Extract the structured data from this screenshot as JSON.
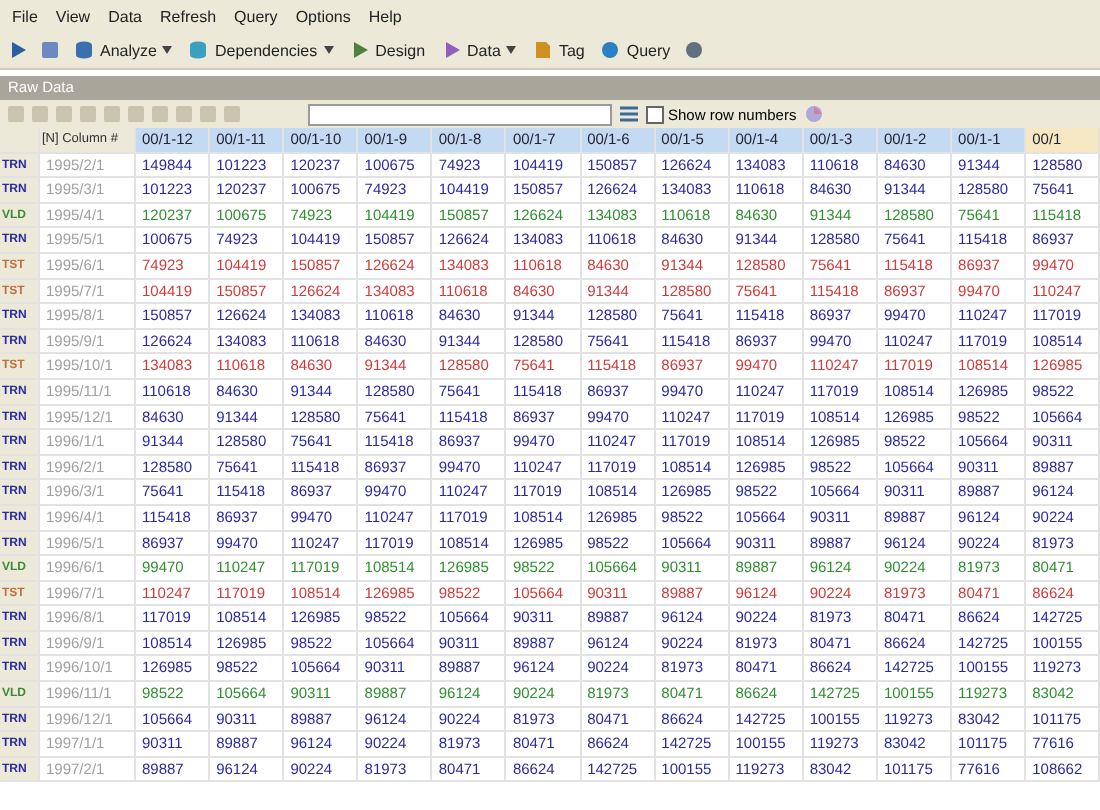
{
  "menu": [
    "File",
    "View",
    "Data",
    "Refresh",
    "Query",
    "Options",
    "Help"
  ],
  "toolbar": [
    {
      "label": "Analyze",
      "dropdown": true
    },
    {
      "label": "Dependencies",
      "dropdown": true
    },
    {
      "label": "Design",
      "dropdown": false
    },
    {
      "label": "Data",
      "dropdown": true
    },
    {
      "label": "Tag",
      "dropdown": false
    },
    {
      "label": "Query",
      "dropdown": false
    }
  ],
  "panel_title": "Raw Data",
  "grid_toolbar": {
    "show_row_numbers": {
      "label": "Show row numbers",
      "checked": false
    }
  },
  "table": {
    "columns": [
      "[N] Column #",
      "00/1-12",
      "00/1-11",
      "00/1-10",
      "00/1-9",
      "00/1-8",
      "00/1-7",
      "00/1-6",
      "00/1-5",
      "00/1-4",
      "00/1-3",
      "00/1-2",
      "00/1-1",
      "00/1"
    ],
    "rows": [
      {
        "kind": "train",
        "tag": "TRN",
        "date": "1995/2/1",
        "values": [
          "149844",
          "101223",
          "120237",
          "100675",
          "74923",
          "104419",
          "150857",
          "126624",
          "134083",
          "110618",
          "84630",
          "91344",
          "128580"
        ]
      },
      {
        "kind": "train",
        "tag": "TRN",
        "date": "1995/3/1",
        "values": [
          "101223",
          "120237",
          "100675",
          "74923",
          "104419",
          "150857",
          "126624",
          "134083",
          "110618",
          "84630",
          "91344",
          "128580",
          "75641"
        ]
      },
      {
        "kind": "valid",
        "tag": "VLD",
        "date": "1995/4/1",
        "values": [
          "120237",
          "100675",
          "74923",
          "104419",
          "150857",
          "126624",
          "134083",
          "110618",
          "84630",
          "91344",
          "128580",
          "75641",
          "115418"
        ]
      },
      {
        "kind": "train",
        "tag": "TRN",
        "date": "1995/5/1",
        "values": [
          "100675",
          "74923",
          "104419",
          "150857",
          "126624",
          "134083",
          "110618",
          "84630",
          "91344",
          "128580",
          "75641",
          "115418",
          "86937"
        ]
      },
      {
        "kind": "test",
        "tag": "TST",
        "date": "1995/6/1",
        "values": [
          "74923",
          "104419",
          "150857",
          "126624",
          "134083",
          "110618",
          "84630",
          "91344",
          "128580",
          "75641",
          "115418",
          "86937",
          "99470"
        ]
      },
      {
        "kind": "test",
        "tag": "TST",
        "date": "1995/7/1",
        "values": [
          "104419",
          "150857",
          "126624",
          "134083",
          "110618",
          "84630",
          "91344",
          "128580",
          "75641",
          "115418",
          "86937",
          "99470",
          "110247"
        ]
      },
      {
        "kind": "train",
        "tag": "TRN",
        "date": "1995/8/1",
        "values": [
          "150857",
          "126624",
          "134083",
          "110618",
          "84630",
          "91344",
          "128580",
          "75641",
          "115418",
          "86937",
          "99470",
          "110247",
          "117019"
        ]
      },
      {
        "kind": "train",
        "tag": "TRN",
        "date": "1995/9/1",
        "values": [
          "126624",
          "134083",
          "110618",
          "84630",
          "91344",
          "128580",
          "75641",
          "115418",
          "86937",
          "99470",
          "110247",
          "117019",
          "108514"
        ]
      },
      {
        "kind": "test",
        "tag": "TST",
        "date": "1995/10/1",
        "values": [
          "134083",
          "110618",
          "84630",
          "91344",
          "128580",
          "75641",
          "115418",
          "86937",
          "99470",
          "110247",
          "117019",
          "108514",
          "126985"
        ]
      },
      {
        "kind": "train",
        "tag": "TRN",
        "date": "1995/11/1",
        "values": [
          "110618",
          "84630",
          "91344",
          "128580",
          "75641",
          "115418",
          "86937",
          "99470",
          "110247",
          "117019",
          "108514",
          "126985",
          "98522"
        ]
      },
      {
        "kind": "train",
        "tag": "TRN",
        "date": "1995/12/1",
        "values": [
          "84630",
          "91344",
          "128580",
          "75641",
          "115418",
          "86937",
          "99470",
          "110247",
          "117019",
          "108514",
          "126985",
          "98522",
          "105664"
        ]
      },
      {
        "kind": "train",
        "tag": "TRN",
        "date": "1996/1/1",
        "values": [
          "91344",
          "128580",
          "75641",
          "115418",
          "86937",
          "99470",
          "110247",
          "117019",
          "108514",
          "126985",
          "98522",
          "105664",
          "90311"
        ]
      },
      {
        "kind": "train",
        "tag": "TRN",
        "date": "1996/2/1",
        "values": [
          "128580",
          "75641",
          "115418",
          "86937",
          "99470",
          "110247",
          "117019",
          "108514",
          "126985",
          "98522",
          "105664",
          "90311",
          "89887"
        ]
      },
      {
        "kind": "train",
        "tag": "TRN",
        "date": "1996/3/1",
        "values": [
          "75641",
          "115418",
          "86937",
          "99470",
          "110247",
          "117019",
          "108514",
          "126985",
          "98522",
          "105664",
          "90311",
          "89887",
          "96124"
        ]
      },
      {
        "kind": "train",
        "tag": "TRN",
        "date": "1996/4/1",
        "values": [
          "115418",
          "86937",
          "99470",
          "110247",
          "117019",
          "108514",
          "126985",
          "98522",
          "105664",
          "90311",
          "89887",
          "96124",
          "90224"
        ]
      },
      {
        "kind": "train",
        "tag": "TRN",
        "date": "1996/5/1",
        "values": [
          "86937",
          "99470",
          "110247",
          "117019",
          "108514",
          "126985",
          "98522",
          "105664",
          "90311",
          "89887",
          "96124",
          "90224",
          "81973"
        ]
      },
      {
        "kind": "valid",
        "tag": "VLD",
        "date": "1996/6/1",
        "values": [
          "99470",
          "110247",
          "117019",
          "108514",
          "126985",
          "98522",
          "105664",
          "90311",
          "89887",
          "96124",
          "90224",
          "81973",
          "80471"
        ]
      },
      {
        "kind": "test",
        "tag": "TST",
        "date": "1996/7/1",
        "values": [
          "110247",
          "117019",
          "108514",
          "126985",
          "98522",
          "105664",
          "90311",
          "89887",
          "96124",
          "90224",
          "81973",
          "80471",
          "86624"
        ]
      },
      {
        "kind": "train",
        "tag": "TRN",
        "date": "1996/8/1",
        "values": [
          "117019",
          "108514",
          "126985",
          "98522",
          "105664",
          "90311",
          "89887",
          "96124",
          "90224",
          "81973",
          "80471",
          "86624",
          "142725"
        ]
      },
      {
        "kind": "train",
        "tag": "TRN",
        "date": "1996/9/1",
        "values": [
          "108514",
          "126985",
          "98522",
          "105664",
          "90311",
          "89887",
          "96124",
          "90224",
          "81973",
          "80471",
          "86624",
          "142725",
          "100155"
        ]
      },
      {
        "kind": "train",
        "tag": "TRN",
        "date": "1996/10/1",
        "values": [
          "126985",
          "98522",
          "105664",
          "90311",
          "89887",
          "96124",
          "90224",
          "81973",
          "80471",
          "86624",
          "142725",
          "100155",
          "119273"
        ]
      },
      {
        "kind": "valid",
        "tag": "VLD",
        "date": "1996/11/1",
        "values": [
          "98522",
          "105664",
          "90311",
          "89887",
          "96124",
          "90224",
          "81973",
          "80471",
          "86624",
          "142725",
          "100155",
          "119273",
          "83042"
        ]
      },
      {
        "kind": "train",
        "tag": "TRN",
        "date": "1996/12/1",
        "values": [
          "105664",
          "90311",
          "89887",
          "96124",
          "90224",
          "81973",
          "80471",
          "86624",
          "142725",
          "100155",
          "119273",
          "83042",
          "101175"
        ]
      },
      {
        "kind": "train",
        "tag": "TRN",
        "date": "1997/1/1",
        "values": [
          "90311",
          "89887",
          "96124",
          "90224",
          "81973",
          "80471",
          "86624",
          "142725",
          "100155",
          "119273",
          "83042",
          "101175",
          "77616"
        ]
      },
      {
        "kind": "train",
        "tag": "TRN",
        "date": "1997/2/1",
        "values": [
          "89887",
          "96124",
          "90224",
          "81973",
          "80471",
          "86624",
          "142725",
          "100155",
          "119273",
          "83042",
          "101175",
          "77616",
          "108662"
        ]
      }
    ]
  }
}
